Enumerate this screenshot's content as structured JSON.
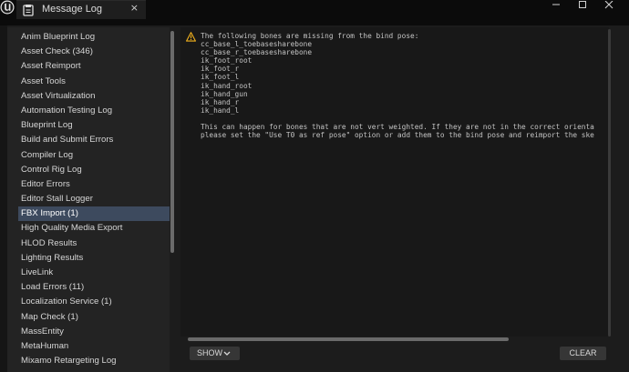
{
  "window": {
    "title": "Message Log",
    "close_glyph": "×"
  },
  "icons": {
    "app_logo": "unreal-logo-icon",
    "tab": "message-log-icon",
    "warning": "warning-icon",
    "show_dropdown": "chevron-down-icon"
  },
  "colors": {
    "selected_item": "#3d4a5e",
    "warning": "#f3b21c",
    "background": "#151515"
  },
  "sidebar": {
    "items": [
      {
        "label": "Anim Blueprint Log"
      },
      {
        "label": "Asset Check (346)"
      },
      {
        "label": "Asset Reimport"
      },
      {
        "label": "Asset Tools"
      },
      {
        "label": "Asset Virtualization"
      },
      {
        "label": "Automation Testing Log"
      },
      {
        "label": "Blueprint Log"
      },
      {
        "label": "Build and Submit Errors"
      },
      {
        "label": "Compiler Log"
      },
      {
        "label": "Control Rig Log"
      },
      {
        "label": "Editor Errors"
      },
      {
        "label": "Editor Stall Logger"
      },
      {
        "label": "FBX Import (1)",
        "selected": true
      },
      {
        "label": "High Quality Media Export"
      },
      {
        "label": "HLOD Results"
      },
      {
        "label": "Lighting Results"
      },
      {
        "label": "LiveLink"
      },
      {
        "label": "Load Errors (11)"
      },
      {
        "label": "Localization Service (1)"
      },
      {
        "label": "Map Check (1)"
      },
      {
        "label": "MassEntity"
      },
      {
        "label": "MetaHuman"
      },
      {
        "label": "Mixamo Retargeting Log"
      }
    ]
  },
  "log": {
    "message": "The following bones are missing from the bind pose:\ncc_base_l_toebasesharebone\ncc_base_r_toebasesharebone\nik_foot_root\nik_foot_r\nik_foot_l\nik_hand_root\nik_hand_gun\nik_hand_r\nik_hand_l\n\nThis can happen for bones that are not vert weighted. If they are not in the correct orienta\nplease set the \"Use T0 as ref pose\" option or add them to the bind pose and reimport the ske"
  },
  "toolbar": {
    "show_label": "SHOW",
    "clear_label": "CLEAR"
  }
}
